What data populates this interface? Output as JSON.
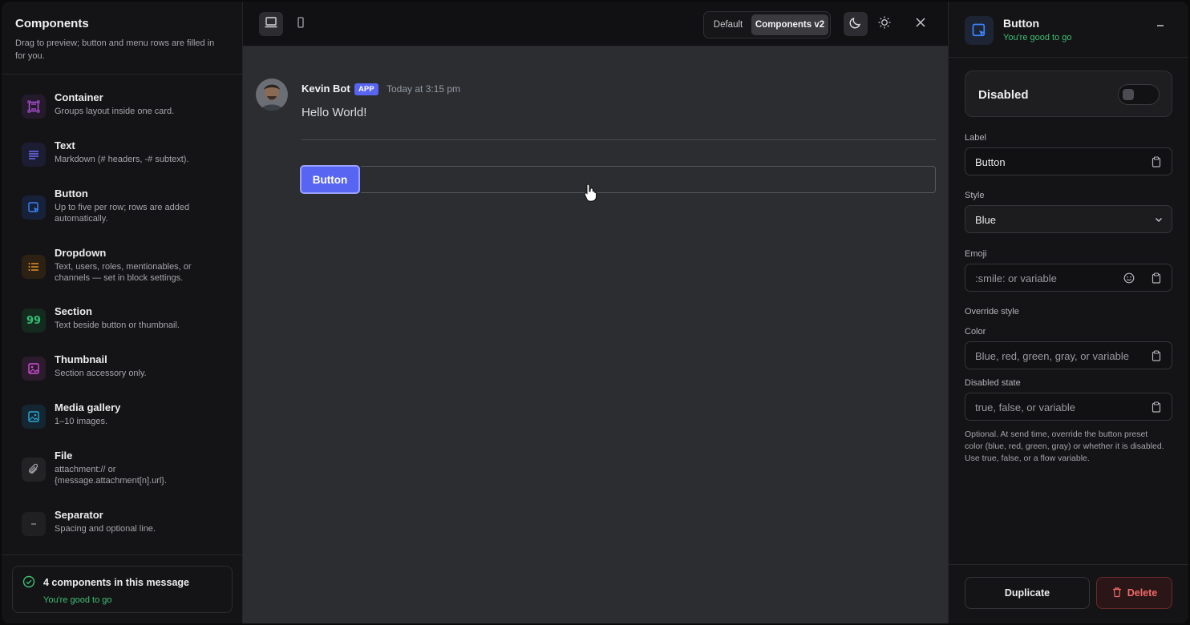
{
  "sidebar": {
    "title": "Components",
    "subtitle": "Drag to preview; button and menu rows are filled in for you.",
    "items": [
      {
        "name": "Container",
        "desc": "Groups layout inside one card.",
        "icon": "container-icon",
        "color": "#b455e0"
      },
      {
        "name": "Text",
        "desc": "Markdown (# headers, -# subtext).",
        "icon": "text-lines-icon",
        "color": "#6b6cf0"
      },
      {
        "name": "Button",
        "desc": "Up to five per row; rows are added automatically.",
        "icon": "button-cursor-icon",
        "color": "#3b82f6"
      },
      {
        "name": "Dropdown",
        "desc": "Text, users, roles, mentionables, or channels — set in block settings.",
        "icon": "list-icon",
        "color": "#e0902a"
      },
      {
        "name": "Section",
        "desc": "Text beside button or thumbnail.",
        "icon": "quote-icon",
        "color": "#2fbf71"
      },
      {
        "name": "Thumbnail",
        "desc": "Section accessory only.",
        "icon": "image-icon",
        "color": "#d14fd6"
      },
      {
        "name": "Media gallery",
        "desc": "1–10 images.",
        "icon": "gallery-icon",
        "color": "#2aa7d8"
      },
      {
        "name": "File",
        "desc": "attachment:// or {message.attachment[n].url}.",
        "icon": "paperclip-icon",
        "color": "#9a9aa0"
      },
      {
        "name": "Separator",
        "desc": "Spacing and optional line.",
        "icon": "minus-icon",
        "color": "#8a8a90"
      }
    ],
    "status": {
      "title": "4 components in this message",
      "ok": "You're good to go"
    }
  },
  "toolbar": {
    "segments": {
      "default": "Default",
      "v2": "Components v2"
    }
  },
  "preview": {
    "author": "Kevin Bot",
    "badge": "APP",
    "timestamp": "Today at 3:15 pm",
    "message": "Hello World!",
    "button_label": "Button"
  },
  "panel": {
    "title": "Button",
    "ok": "You're good to go",
    "disabled_label": "Disabled",
    "disabled_value": false,
    "label_field": {
      "label": "Label",
      "value": "Button"
    },
    "style_field": {
      "label": "Style",
      "value": "Blue"
    },
    "emoji_field": {
      "label": "Emoji",
      "placeholder": ":smile: or variable"
    },
    "override_heading": "Override style",
    "color_field": {
      "label": "Color",
      "placeholder": "Blue, red, green, gray, or variable"
    },
    "disabled_state_field": {
      "label": "Disabled state",
      "placeholder": "true, false, or variable"
    },
    "helper": "Optional. At send time, override the button preset color (blue, red, green, gray) or whether it is disabled. Use true, false, or a flow variable.",
    "duplicate": "Duplicate",
    "delete": "Delete"
  },
  "colors": {
    "accent": "#5865f2",
    "success": "#3fbf74",
    "danger": "#f06a6a"
  }
}
